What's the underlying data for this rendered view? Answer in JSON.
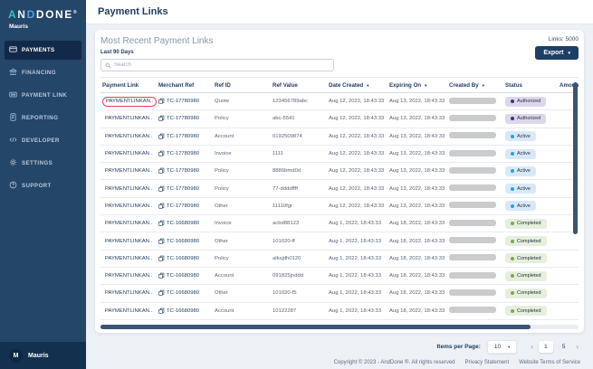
{
  "icons": {
    "caret_down": "▾",
    "chevron_left": "‹",
    "chevron_right": "›"
  },
  "colors": {
    "sidebar_bg": "#234669",
    "sidebar_active_bg": "#12294a",
    "accent_navy": "#1d3e66",
    "annotation_red": "#e8405a",
    "scrollbar": "#3c5473",
    "logo_teal": "#35c3b2",
    "logo_blue": "#4fa3dd"
  },
  "sidebar": {
    "logo": {
      "a": "A",
      "n": "N",
      "d": "D",
      "rest": "DONE",
      "reg": "®"
    },
    "subtitle": "Mauris",
    "items": [
      {
        "label": "PAYMENTS",
        "icon": "payments-icon",
        "active": true
      },
      {
        "label": "FINANCING",
        "icon": "financing-icon",
        "active": false
      },
      {
        "label": "PAYMENT LINK",
        "icon": "payment-link-icon",
        "active": false
      },
      {
        "label": "REPORTING",
        "icon": "reporting-icon",
        "active": false
      },
      {
        "label": "DEVELOPER",
        "icon": "developer-icon",
        "active": false
      },
      {
        "label": "SETTINGS",
        "icon": "settings-icon",
        "active": false
      },
      {
        "label": "SUPPORT",
        "icon": "support-icon",
        "active": false
      }
    ],
    "user": {
      "initial": "M",
      "name": "Mauris"
    }
  },
  "header": {
    "title": "Payment Links"
  },
  "panel": {
    "title": "Most Recent Payment Links",
    "subtitle": "Last 90 Days",
    "links_count_label": "Links: 5000",
    "export_label": "Export",
    "search_placeholder": "Search"
  },
  "table": {
    "columns": [
      "Payment Link",
      "Merchant Ref",
      "Ref ID",
      "Ref Value",
      "Date Created",
      "Expiring On",
      "Created By",
      "Status",
      "Amount"
    ],
    "sortable_columns": [
      "Date Created",
      "Expiring On",
      "Created By"
    ],
    "status_styles": {
      "Authorized": {
        "bg": "#dcd7ec",
        "dot": "#41347a"
      },
      "Active": {
        "bg": "#d7e9f9",
        "dot": "#2f9de2"
      },
      "Completed": {
        "bg": "#e5efde",
        "dot": "#7da854"
      }
    },
    "rows": [
      {
        "payment_link": "PAYMENTLINKAN..",
        "merchant_ref": "TC-17780980",
        "ref_id": "Quote",
        "ref_value": "123456789abc",
        "date_created": "Aug 12, 2022, 18:43:33",
        "expiring_on": "Aug 13, 2022, 18:43:33",
        "created_by_redacted": true,
        "status": "Authorized",
        "amount": "",
        "annotated": true
      },
      {
        "payment_link": "PAYMENTLINKAN..",
        "merchant_ref": "TC-17780980",
        "ref_id": "Policy",
        "ref_value": "abc-5541",
        "date_created": "Aug 12, 2022, 18:43:33",
        "expiring_on": "Aug 13, 2022, 18:43:33",
        "created_by_redacted": true,
        "status": "Authorized",
        "amount": "",
        "annotated": false
      },
      {
        "payment_link": "PAYMENTLINKAN..",
        "merchant_ref": "TC-17780980",
        "ref_id": "Account",
        "ref_value": "0192509874",
        "date_created": "Aug 12, 2022, 18:43:33",
        "expiring_on": "Aug 13, 2022, 18:43:33",
        "created_by_redacted": true,
        "status": "Active",
        "amount": "",
        "annotated": false
      },
      {
        "payment_link": "PAYMENTLINKAN..",
        "merchant_ref": "TC-17780980",
        "ref_id": "Invoice",
        "ref_value": "1111",
        "date_created": "Aug 12, 2022, 18:43:33",
        "expiring_on": "Aug 13, 2022, 18:43:33",
        "created_by_redacted": true,
        "status": "Active",
        "amount": "",
        "annotated": false
      },
      {
        "payment_link": "PAYMENTLINKAN..",
        "merchant_ref": "TC-17780980",
        "ref_id": "Policy",
        "ref_value": "8886bmd0d",
        "date_created": "Aug 12, 2022, 18:43:33",
        "expiring_on": "Aug 13, 2022, 18:43:33",
        "created_by_redacted": true,
        "status": "Active",
        "amount": "",
        "annotated": false
      },
      {
        "payment_link": "PAYMENTLINKAN..",
        "merchant_ref": "TC-17780980",
        "ref_id": "Policy",
        "ref_value": "77-ddddffff",
        "date_created": "Aug 12, 2022, 18:43:33",
        "expiring_on": "Aug 13, 2022, 18:43:33",
        "created_by_redacted": true,
        "status": "Active",
        "amount": "",
        "annotated": false
      },
      {
        "payment_link": "PAYMENTLINKAN..",
        "merchant_ref": "TC-17780980",
        "ref_id": "Other",
        "ref_value": "11110fgr",
        "date_created": "Aug 12, 2022, 18:43:33",
        "expiring_on": "Aug 13, 2022, 18:43:33",
        "created_by_redacted": true,
        "status": "Active",
        "amount": "",
        "annotated": false
      },
      {
        "payment_link": "PAYMENTLINKAN..",
        "merchant_ref": "TC-16680980",
        "ref_id": "Invoice",
        "ref_value": "acbd88123",
        "date_created": "Aug 1, 2022, 18:43:33",
        "expiring_on": "Aug 18, 2022, 18:43:33",
        "created_by_redacted": true,
        "status": "Completed",
        "amount": "",
        "annotated": false
      },
      {
        "payment_link": "PAYMENTLINKAN..",
        "merchant_ref": "TC-16680980",
        "ref_id": "Other",
        "ref_value": "101020-ff",
        "date_created": "Aug 1, 2022, 18:43:33",
        "expiring_on": "Aug 18, 2022, 18:43:33",
        "created_by_redacted": true,
        "status": "Completed",
        "amount": "",
        "annotated": false
      },
      {
        "payment_link": "PAYMENTLINKAN..",
        "merchant_ref": "TC-16680980",
        "ref_id": "Policy",
        "ref_value": "alksjdh0120",
        "date_created": "Aug 1, 2022, 18:43:33",
        "expiring_on": "Aug 18, 2022, 18:43:33",
        "created_by_redacted": true,
        "status": "Completed",
        "amount": "",
        "annotated": false
      },
      {
        "payment_link": "PAYMENTLINKAN..",
        "merchant_ref": "TC-16680980",
        "ref_id": "Account",
        "ref_value": "091825jnddd",
        "date_created": "Aug 1, 2022, 18:43:33",
        "expiring_on": "Aug 18, 2022, 18:43:33",
        "created_by_redacted": true,
        "status": "Completed",
        "amount": "",
        "annotated": false
      },
      {
        "payment_link": "PAYMENTLINKAN..",
        "merchant_ref": "TC-16680980",
        "ref_id": "Other",
        "ref_value": "101020-f5",
        "date_created": "Aug 1, 2022, 18:43:33",
        "expiring_on": "Aug 18, 2022, 18:43:33",
        "created_by_redacted": true,
        "status": "Completed",
        "amount": "",
        "annotated": false
      },
      {
        "payment_link": "PAYMENTLINKAN..",
        "merchant_ref": "TC-16680980",
        "ref_id": "Account",
        "ref_value": "10122287",
        "date_created": "Aug 1, 2022, 18:43:33",
        "expiring_on": "Aug 18, 2022, 18:43:33",
        "created_by_redacted": true,
        "status": "Completed",
        "amount": "",
        "annotated": false
      }
    ]
  },
  "pagination": {
    "items_per_page_label": "Items per Page:",
    "items_per_page_value": "10",
    "pages": [
      "1",
      "5"
    ],
    "current_page": "1"
  },
  "footer": {
    "copyright": "Copyright © 2023 - AndDone ®. All rights reserved",
    "links": [
      "Privacy Statement",
      "Website Terms of Service"
    ]
  }
}
